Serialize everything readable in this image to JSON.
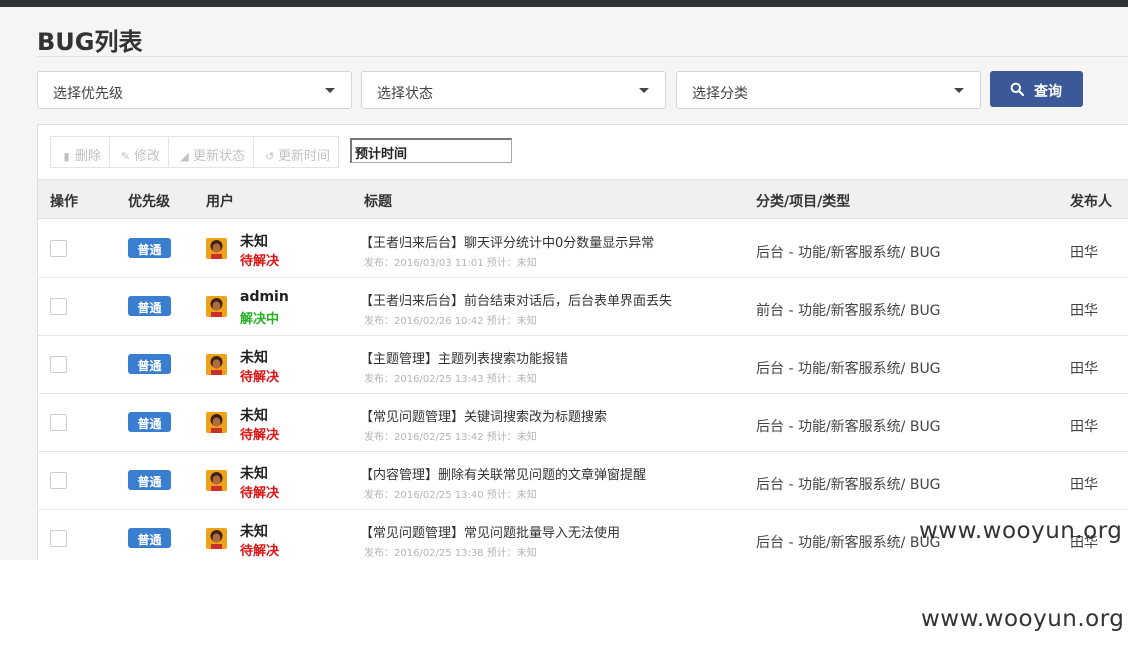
{
  "page": {
    "title": "BUG列表"
  },
  "filters": {
    "priority_placeholder": "选择优先级",
    "status_placeholder": "选择状态",
    "category_placeholder": "选择分类",
    "query_label": "查询"
  },
  "toolbar": {
    "delete_label": "删除",
    "edit_label": "修改",
    "update_status_label": "更新状态",
    "update_time_label": "更新时间",
    "time_input_value": "预计时间"
  },
  "table": {
    "headers": {
      "action": "操作",
      "priority": "优先级",
      "user": "用户",
      "title": "标题",
      "category": "分类/项目/类型",
      "author": "发布人"
    },
    "rows": [
      {
        "priority": "普通",
        "user": "未知",
        "status": "待解决",
        "title": "【王者归来后台】聊天评分统计中0分数量显示异常",
        "meta": "发布：2016/03/03 11:01   预计：未知",
        "category": "后台 - 功能/新客服系统/ BUG",
        "author": "田华"
      },
      {
        "priority": "普通",
        "user": "admin",
        "status": "解决中",
        "title": "【王者归来后台】前台结束对话后，后台表单界面丢失",
        "meta": "发布：2016/02/26 10:42   预计：未知",
        "category": "前台 - 功能/新客服系统/ BUG",
        "author": "田华"
      },
      {
        "priority": "普通",
        "user": "未知",
        "status": "待解决",
        "title": "【主题管理】主题列表搜索功能报错",
        "meta": "发布：2016/02/25 13:43   预计：未知",
        "category": "后台 - 功能/新客服系统/ BUG",
        "author": "田华"
      },
      {
        "priority": "普通",
        "user": "未知",
        "status": "待解决",
        "title": "【常见问题管理】关键词搜索改为标题搜索",
        "meta": "发布：2016/02/25 13:42   预计：未知",
        "category": "后台 - 功能/新客服系统/ BUG",
        "author": "田华"
      },
      {
        "priority": "普通",
        "user": "未知",
        "status": "待解决",
        "title": "【内容管理】删除有关联常见问题的文章弹窗提醒",
        "meta": "发布：2016/02/25 13:40   预计：未知",
        "category": "后台 - 功能/新客服系统/ BUG",
        "author": "田华"
      },
      {
        "priority": "普通",
        "user": "未知",
        "status": "待解决",
        "title": "【常见问题管理】常见问题批量导入无法使用",
        "meta": "发布：2016/02/25 13:38   预计：未知",
        "category": "后台 - 功能/新客服系统/ BUG",
        "author": "田华"
      }
    ]
  },
  "watermarks": {
    "mid": "www.wooyun.org",
    "bottom": "www.wooyun.org"
  },
  "colors": {
    "primary_button": "#3b5998",
    "priority_badge": "#3a7fcf",
    "status_pending": "#e01414",
    "status_in_progress": "#22b322"
  }
}
